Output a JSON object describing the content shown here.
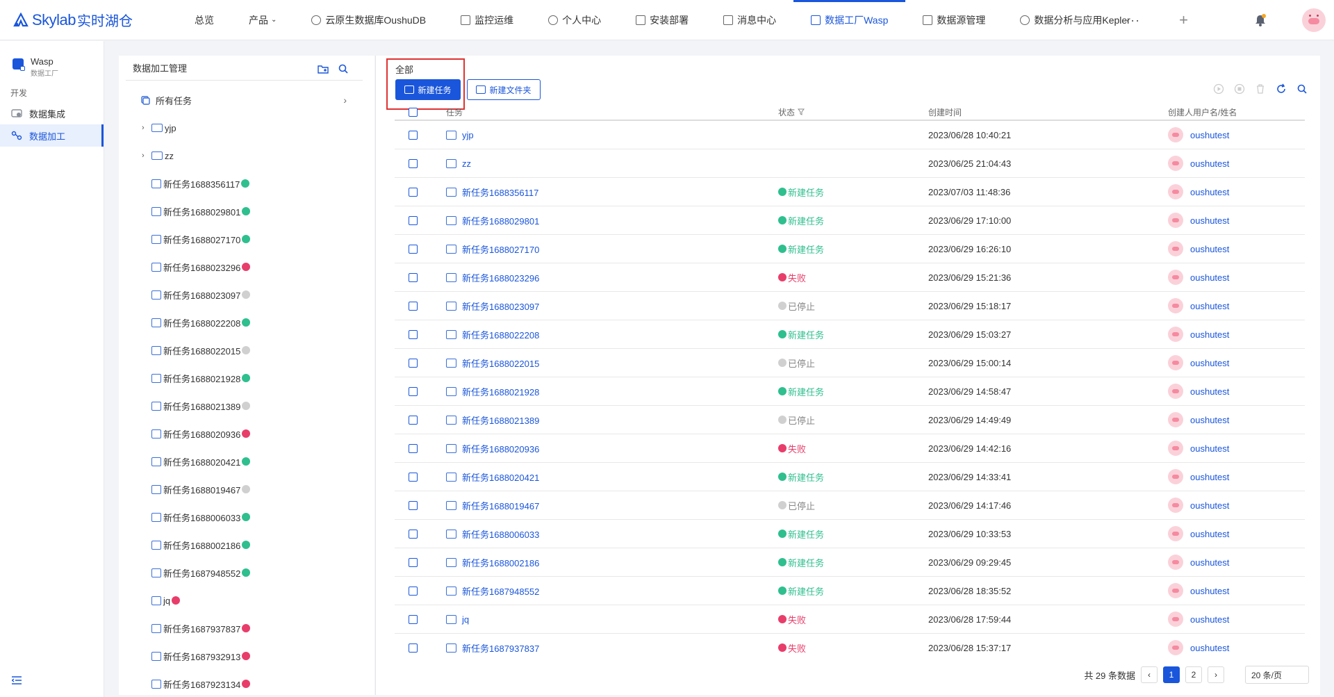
{
  "brand": {
    "logo_text": "Skylab",
    "logo_cn": "实时湖仓"
  },
  "nav": [
    {
      "label": "总览",
      "icon": "none"
    },
    {
      "label": "产品",
      "icon": "chevron-down"
    },
    {
      "label": "云原生数据库OushuDB",
      "icon": "db-icon"
    },
    {
      "label": "监控运维",
      "icon": "monitor-icon"
    },
    {
      "label": "个人中心",
      "icon": "user-icon"
    },
    {
      "label": "安装部署",
      "icon": "wrench-icon"
    },
    {
      "label": "消息中心",
      "icon": "bell-icon"
    },
    {
      "label": "数据工厂Wasp",
      "icon": "wasp-icon"
    },
    {
      "label": "数据源管理",
      "icon": "doc-icon"
    },
    {
      "label": "数据分析与应用Kepler",
      "icon": "kepler-icon"
    }
  ],
  "sidebar": {
    "app_name": "Wasp",
    "app_sub": "数据工厂",
    "section": "开发",
    "items": [
      {
        "label": "数据集成"
      },
      {
        "label": "数据加工"
      }
    ]
  },
  "tree": {
    "title": "数据加工管理",
    "all_label": "所有任务",
    "folders": [
      "yjp",
      "zz"
    ],
    "tasks": [
      {
        "name": "新任务1688356117",
        "status": "ok"
      },
      {
        "name": "新任务1688029801",
        "status": "ok"
      },
      {
        "name": "新任务1688027170",
        "status": "ok"
      },
      {
        "name": "新任务1688023296",
        "status": "fail"
      },
      {
        "name": "新任务1688023097",
        "status": "stop"
      },
      {
        "name": "新任务1688022208",
        "status": "ok"
      },
      {
        "name": "新任务1688022015",
        "status": "stop"
      },
      {
        "name": "新任务1688021928",
        "status": "ok"
      },
      {
        "name": "新任务1688021389",
        "status": "stop"
      },
      {
        "name": "新任务1688020936",
        "status": "fail"
      },
      {
        "name": "新任务1688020421",
        "status": "ok"
      },
      {
        "name": "新任务1688019467",
        "status": "stop"
      },
      {
        "name": "新任务1688006033",
        "status": "ok"
      },
      {
        "name": "新任务1688002186",
        "status": "ok"
      },
      {
        "name": "新任务1687948552",
        "status": "ok"
      },
      {
        "name": "jq",
        "status": "fail"
      },
      {
        "name": "新任务1687937837",
        "status": "fail"
      },
      {
        "name": "新任务1687932913",
        "status": "fail"
      },
      {
        "name": "新任务1687923134",
        "status": "fail"
      }
    ]
  },
  "main": {
    "crumb": "全部",
    "new_task": "新建任务",
    "new_folder": "新建文件夹",
    "columns": {
      "task": "任务",
      "status": "状态",
      "created": "创建时间",
      "creator": "创建人用户名/姓名"
    },
    "rows": [
      {
        "type": "folder",
        "name": "yjp",
        "status": "",
        "status_type": "",
        "time": "2023/06/28 10:40:21",
        "user": "oushutest"
      },
      {
        "type": "folder",
        "name": "zz",
        "status": "",
        "status_type": "",
        "time": "2023/06/25 21:04:43",
        "user": "oushutest"
      },
      {
        "type": "task",
        "name": "新任务1688356117",
        "status": "新建任务",
        "status_type": "ok",
        "time": "2023/07/03 11:48:36",
        "user": "oushutest"
      },
      {
        "type": "task",
        "name": "新任务1688029801",
        "status": "新建任务",
        "status_type": "ok",
        "time": "2023/06/29 17:10:00",
        "user": "oushutest"
      },
      {
        "type": "task",
        "name": "新任务1688027170",
        "status": "新建任务",
        "status_type": "ok",
        "time": "2023/06/29 16:26:10",
        "user": "oushutest"
      },
      {
        "type": "task",
        "name": "新任务1688023296",
        "status": "失败",
        "status_type": "fail",
        "time": "2023/06/29 15:21:36",
        "user": "oushutest"
      },
      {
        "type": "task",
        "name": "新任务1688023097",
        "status": "已停止",
        "status_type": "stop",
        "time": "2023/06/29 15:18:17",
        "user": "oushutest"
      },
      {
        "type": "task",
        "name": "新任务1688022208",
        "status": "新建任务",
        "status_type": "ok",
        "time": "2023/06/29 15:03:27",
        "user": "oushutest"
      },
      {
        "type": "task",
        "name": "新任务1688022015",
        "status": "已停止",
        "status_type": "stop",
        "time": "2023/06/29 15:00:14",
        "user": "oushutest"
      },
      {
        "type": "task",
        "name": "新任务1688021928",
        "status": "新建任务",
        "status_type": "ok",
        "time": "2023/06/29 14:58:47",
        "user": "oushutest"
      },
      {
        "type": "task",
        "name": "新任务1688021389",
        "status": "已停止",
        "status_type": "stop",
        "time": "2023/06/29 14:49:49",
        "user": "oushutest"
      },
      {
        "type": "task",
        "name": "新任务1688020936",
        "status": "失败",
        "status_type": "fail",
        "time": "2023/06/29 14:42:16",
        "user": "oushutest"
      },
      {
        "type": "task",
        "name": "新任务1688020421",
        "status": "新建任务",
        "status_type": "ok",
        "time": "2023/06/29 14:33:41",
        "user": "oushutest"
      },
      {
        "type": "task",
        "name": "新任务1688019467",
        "status": "已停止",
        "status_type": "stop",
        "time": "2023/06/29 14:17:46",
        "user": "oushutest"
      },
      {
        "type": "task",
        "name": "新任务1688006033",
        "status": "新建任务",
        "status_type": "ok",
        "time": "2023/06/29 10:33:53",
        "user": "oushutest"
      },
      {
        "type": "task",
        "name": "新任务1688002186",
        "status": "新建任务",
        "status_type": "ok",
        "time": "2023/06/29 09:29:45",
        "user": "oushutest"
      },
      {
        "type": "task",
        "name": "新任务1687948552",
        "status": "新建任务",
        "status_type": "ok",
        "time": "2023/06/28 18:35:52",
        "user": "oushutest"
      },
      {
        "type": "task",
        "name": "jq",
        "status": "失败",
        "status_type": "fail",
        "time": "2023/06/28 17:59:44",
        "user": "oushutest"
      },
      {
        "type": "task",
        "name": "新任务1687937837",
        "status": "失败",
        "status_type": "fail",
        "time": "2023/06/28 15:37:17",
        "user": "oushutest"
      }
    ],
    "pager": {
      "total": "共 29 条数据",
      "pages": [
        "1",
        "2"
      ],
      "current": "1",
      "page_size": "20 条/页"
    }
  },
  "colors": {
    "accent": "#1a56db",
    "ok": "#2fbf8f",
    "fail": "#e83d6a",
    "stop": "#d0d0d0",
    "highlight": "#e03131"
  }
}
